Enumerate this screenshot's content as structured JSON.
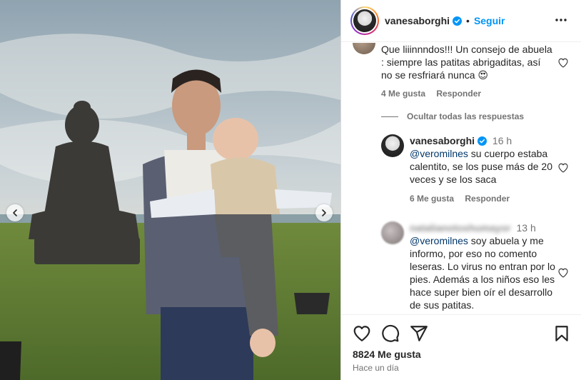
{
  "header": {
    "username": "vanesaborghi",
    "separator": "•",
    "follow_label": "Seguir",
    "more_icon": "more-horizontal-icon"
  },
  "comments": [
    {
      "text": "Que liiinnndos!!! Un consejo de abuela : siempre las patitas abrigaditas, así no se resfriará nunca 😍",
      "likes_label": "4 Me gusta",
      "reply_label": "Responder"
    }
  ],
  "hide_replies_label": "Ocultar todas las respuestas",
  "replies": [
    {
      "username": "vanesaborghi",
      "time": "16 h",
      "mention": "@veromilnes",
      "text": " su cuerpo estaba calentito, se los puse más de 20 veces y se los saca",
      "likes_label": "6 Me gusta",
      "reply_label": "Responder"
    },
    {
      "username": "natalianotoshumayor",
      "time": "13 h",
      "mention": "@veromilnes",
      "text": " soy abuela y me informo, por eso no comento leseras. Lo virus no entran por lo pies. Además a los niños eso les hace super bien oír el desarrollo de sus patitas."
    }
  ],
  "actions": {
    "likes": "8824 Me gusta",
    "posted": "Hace un día"
  },
  "colors": {
    "accent": "#0095f6",
    "mention": "#00376b",
    "secondary_text": "#737373"
  }
}
